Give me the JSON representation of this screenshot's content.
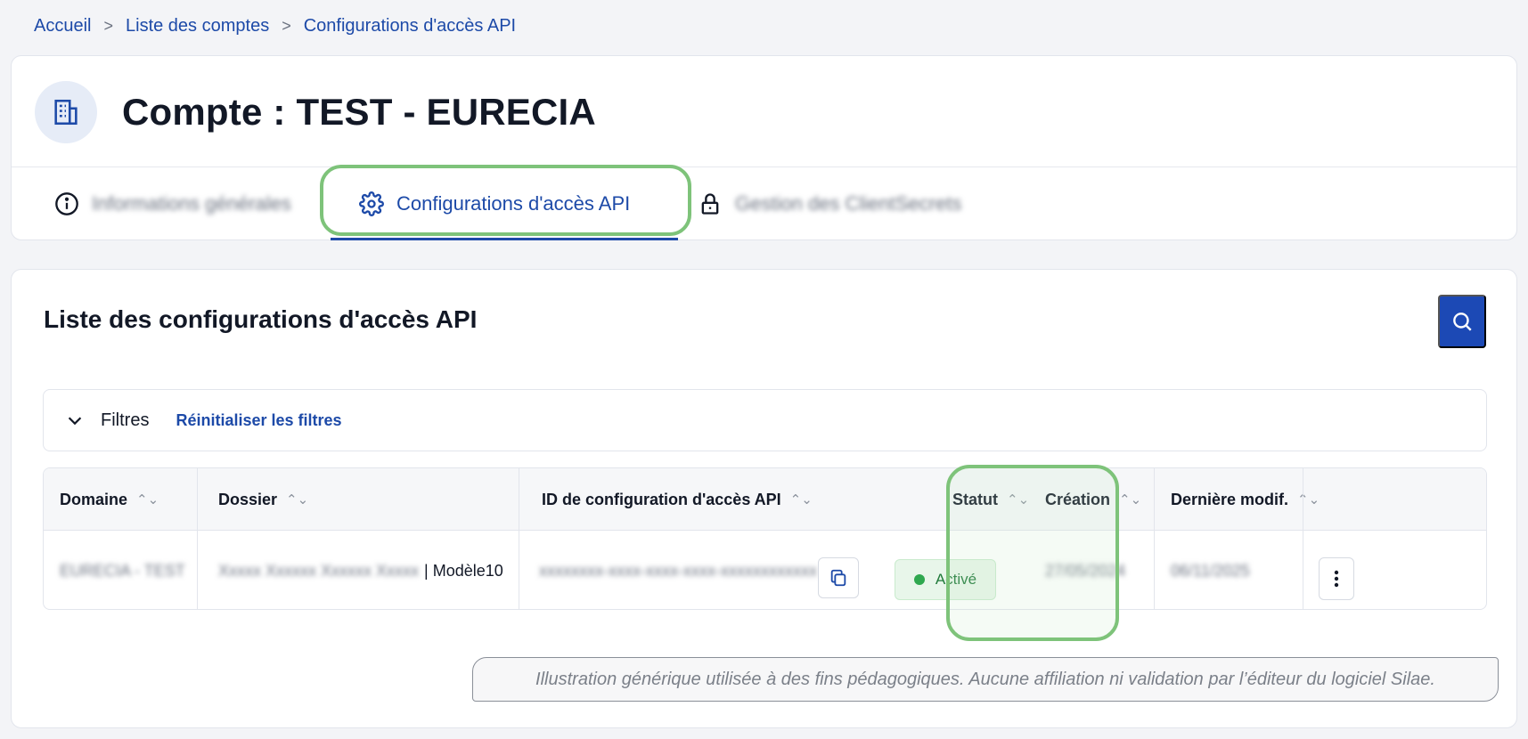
{
  "breadcrumb": {
    "items": [
      "Accueil",
      "Liste des comptes",
      "Configurations d'accès API"
    ],
    "separator": ">"
  },
  "account": {
    "title": "Compte : TEST - EURECIA",
    "icon": "building-icon"
  },
  "tabs": [
    {
      "label": "Informations générales",
      "icon": "info-icon",
      "blurred": true
    },
    {
      "label": "Configurations d'accès API",
      "icon": "gear-icon",
      "active": true
    },
    {
      "label": "Gestion des ClientSecrets",
      "icon": "lock-icon",
      "blurred": true
    }
  ],
  "list": {
    "title": "Liste des configurations d'accès API",
    "search_icon": "search-icon",
    "filters": {
      "label": "Filtres",
      "reset": "Réinitialiser les filtres"
    }
  },
  "table": {
    "columns": [
      "Domaine",
      "Dossier",
      "ID de configuration d'accès API",
      "Statut",
      "Création",
      "Dernière modif."
    ],
    "sort_glyph": "⌃⌄",
    "row": {
      "domaine": "EURECIA - TEST",
      "dossier_blurred": "Xxxxx Xxxxxx Xxxxxx Xxxxx",
      "dossier_suffix": "| Modèle10",
      "config_id": "xxxxxxxx-xxxx-xxxx-xxxx-xxxxxxxxxxxx",
      "statut": "Activé",
      "creation": "27/05/2024",
      "derniere_modif": "06/11/2025"
    }
  },
  "disclaimer": "Illustration générique utilisée à des fins pédagogiques. Aucune affiliation ni validation par l’éditeur du logiciel Silae.",
  "colors": {
    "accent": "#1d4aa8",
    "highlight": "#7ec37a",
    "status_green": "#2fa84f"
  }
}
